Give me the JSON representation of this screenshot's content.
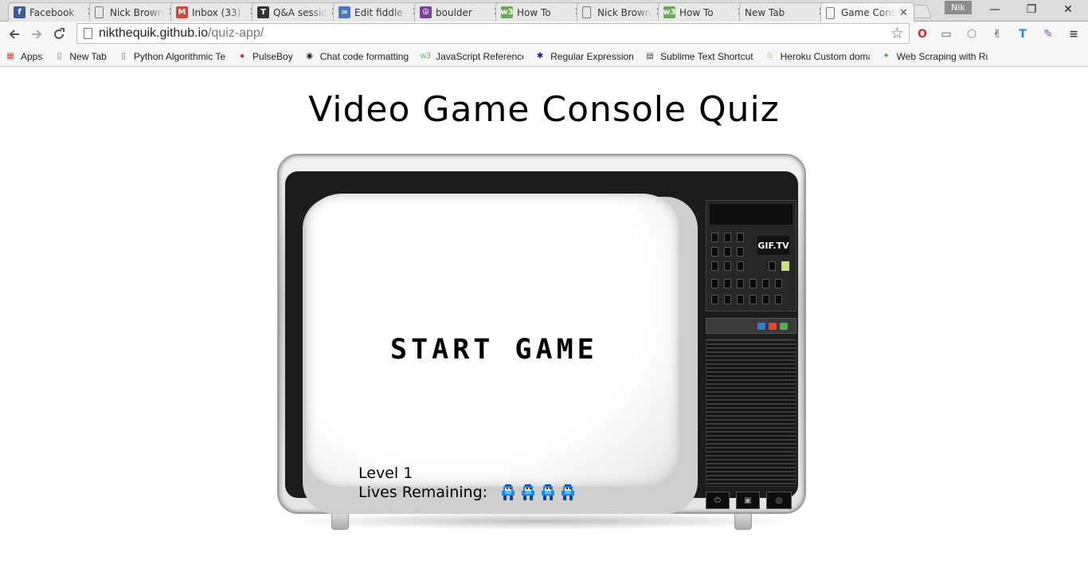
{
  "browser": {
    "tabs": [
      {
        "label": "Facebook",
        "icon": "facebook-icon",
        "color": "#3b5998",
        "glyph": "f"
      },
      {
        "label": "Nick Brown",
        "icon": "page-icon",
        "color": "#ffffff",
        "glyph": ""
      },
      {
        "label": "Inbox (33)",
        "icon": "gmail-icon",
        "color": "#d14836",
        "glyph": "M"
      },
      {
        "label": "Q&A session",
        "icon": "thinkful-icon",
        "color": "#333333",
        "glyph": "T"
      },
      {
        "label": "Edit fiddle",
        "icon": "jsfiddle-icon",
        "color": "#4679bd",
        "glyph": "∞"
      },
      {
        "label": "boulder",
        "icon": "peace-icon",
        "color": "#7b3fa0",
        "glyph": "☮"
      },
      {
        "label": "How To",
        "icon": "w3-icon",
        "color": "#6aa84f",
        "glyph": "w3"
      },
      {
        "label": "Nick Brown",
        "icon": "page-icon",
        "color": "#ffffff",
        "glyph": ""
      },
      {
        "label": "How To",
        "icon": "w3-icon",
        "color": "#6aa84f",
        "glyph": "w3"
      },
      {
        "label": "New Tab",
        "icon": "none",
        "color": "#ffffff",
        "glyph": ""
      },
      {
        "label": "Game Console",
        "icon": "page-icon",
        "color": "#ffffff",
        "glyph": ""
      }
    ],
    "close_glyph": "✕",
    "profile": "Nik",
    "window": {
      "minimize": "—",
      "restore": "❐",
      "close": "✕"
    },
    "address": {
      "host": "nikthequik.github.io",
      "path": "/quiz-app/"
    },
    "bookmarks": [
      {
        "label": "Apps",
        "icon": "apps-grid-icon"
      },
      {
        "label": "New Tab",
        "icon": "page-icon"
      },
      {
        "label": "Python Algorithmic Te",
        "icon": "page-icon"
      },
      {
        "label": "PulseBoy",
        "icon": "pulseboy-icon"
      },
      {
        "label": "Chat code formatting",
        "icon": "github-icon"
      },
      {
        "label": "JavaScript Reference",
        "icon": "w3-icon"
      },
      {
        "label": "Regular Expressions",
        "icon": "regex-icon"
      },
      {
        "label": "Sublime Text Shortcut",
        "icon": "sublime-icon"
      },
      {
        "label": "Heroku Custom doma",
        "icon": "smiley-icon"
      },
      {
        "label": "Web Scraping with Ru",
        "icon": "scraper-icon"
      }
    ]
  },
  "page": {
    "title": "Video Game Console Quiz",
    "tv_brand": "GIF.TV",
    "start_label": "START GAME",
    "level_label": "Level 1",
    "lives_label": "Lives Remaining:",
    "lives_remaining": 4,
    "life_icon": "megaman-icon"
  },
  "colors": {
    "accent_blue": "#1e88e5",
    "indicator_blue": "#2e7fd8",
    "indicator_red": "#e04a2a",
    "indicator_green": "#4caf50"
  }
}
